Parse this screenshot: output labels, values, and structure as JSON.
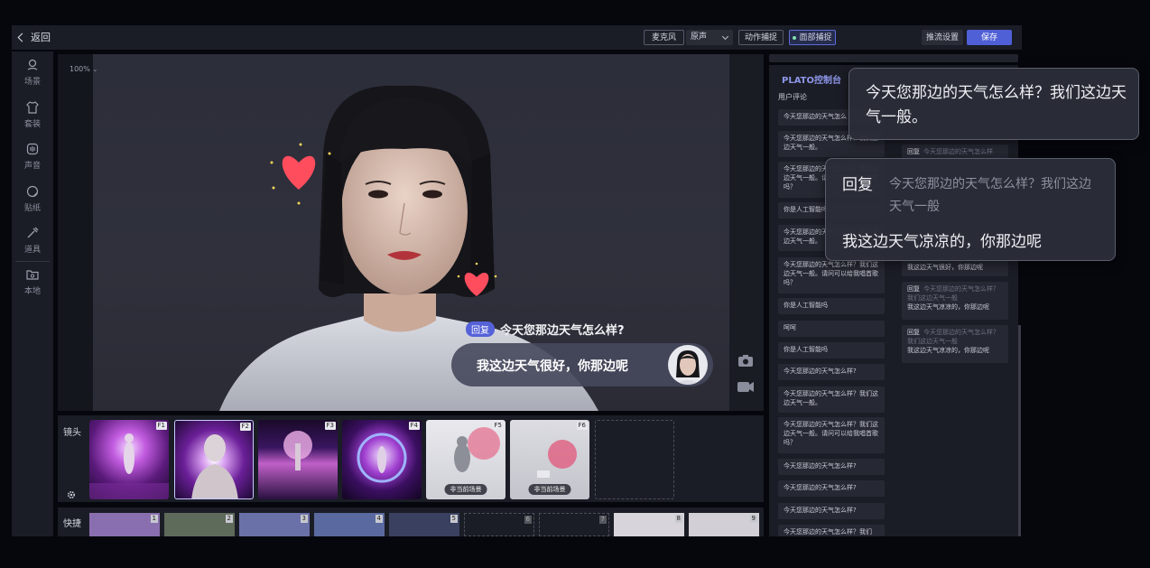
{
  "topbar": {
    "back_label": "返回",
    "mic_label": "麦克风",
    "voice_select": "原声",
    "motion_capture": "动作捕捉",
    "face_capture": "面部捕捉",
    "stream_settings": "推流设置",
    "save": "保存"
  },
  "sidebar": {
    "items": [
      {
        "label": "场景",
        "icon": "scene-icon"
      },
      {
        "label": "套装",
        "icon": "outfit-icon"
      },
      {
        "label": "声音",
        "icon": "voice-icon"
      },
      {
        "label": "贴纸",
        "icon": "sticker-icon"
      },
      {
        "label": "道具",
        "icon": "prop-icon"
      },
      {
        "label": "本地",
        "icon": "local-icon"
      }
    ]
  },
  "stage": {
    "zoom": "100%",
    "reply_tag": "回复",
    "reply_question": "今天您那边天气怎么样?",
    "reply_answer": "我这边天气很好，你那边呢"
  },
  "lens": {
    "label": "镜头",
    "thumbs": [
      {
        "key": "F1",
        "badge": ""
      },
      {
        "key": "F2",
        "badge": ""
      },
      {
        "key": "F3",
        "badge": ""
      },
      {
        "key": "F4",
        "badge": ""
      },
      {
        "key": "F5",
        "badge": "非当前场景"
      },
      {
        "key": "F6",
        "badge": "非当前场景"
      }
    ]
  },
  "quick": {
    "label": "快捷",
    "keys": [
      "1",
      "2",
      "3",
      "4",
      "5",
      "6",
      "7",
      "8",
      "9"
    ]
  },
  "control": {
    "title": "PLATO控制台",
    "comments_label": "用户评论",
    "comments": [
      "今天您那边的天气怎么",
      "今天您那边的天气怎么样？我们这边天气一般。",
      "今天您那边的天气怎么样？我们这边天气一般。请问可以给我唱首歌吗？",
      "你是人工智能吗",
      "今天您那边的天气怎么样？我们这边天气一般。",
      "今天您那边的天气怎么样？我们这边天气一般。请问可以给我唱首歌吗？",
      "你是人工智能吗",
      "呵呵",
      "你是人工智能吗",
      "今天您那边的天气怎么样?",
      "今天您那边的天气怎么样？我们这边天气一般。",
      "今天您那边的天气怎么样？我们这边天气一般。请问可以给我唱首歌吗？",
      "今天您那边的天气怎么样?",
      "今天您那边的天气怎么样?",
      "今天您那边的天气怎么样?",
      "今天您那边的天气怎么样？我们"
    ],
    "replies": [
      {
        "tag": "回复",
        "q": "今天您那边的天气怎么样",
        "a": ""
      },
      {
        "tag": "",
        "q": "",
        "a": "我这边天气很好，你那边呢"
      },
      {
        "tag": "回复",
        "q": "今天您那边的天气怎么样？我们这边天气一般",
        "a": "我这边天气凉凉的，你那边呢"
      },
      {
        "tag": "回复",
        "q": "今天您那边的天气怎么样？我们这边天气一般",
        "a": "我这边天气凉凉的，你那边呢"
      }
    ]
  },
  "popup1": {
    "text": "今天您那边的天气怎么样？我们这边天气一般。"
  },
  "popup2": {
    "tag": "回复",
    "quote": "今天您那边的天气怎么样？我们这边天气一般",
    "answer": "我这边天气凉凉的，你那边呢"
  },
  "colors": {
    "accent": "#4f5fd6",
    "panel": "#1b1d26",
    "heart": "#ff4d5e"
  }
}
